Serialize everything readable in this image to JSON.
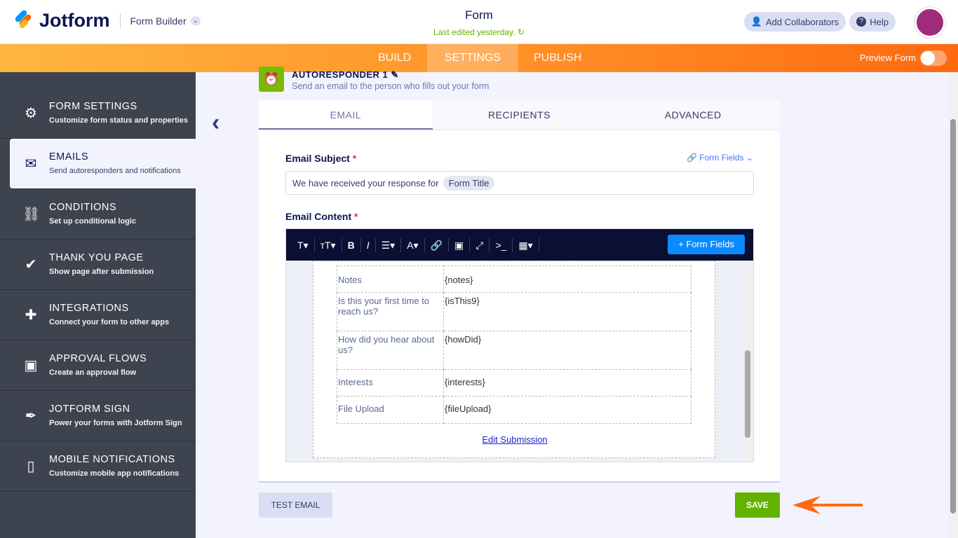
{
  "header": {
    "brand": "Jotform",
    "product": "Form Builder",
    "title": "Form",
    "edited": "Last edited yesterday.",
    "add_collaborators": "Add Collaborators",
    "help": "Help"
  },
  "nav": {
    "tabs": [
      "BUILD",
      "SETTINGS",
      "PUBLISH"
    ],
    "active": "SETTINGS",
    "preview": "Preview Form",
    "preview_on": false
  },
  "sidebar": {
    "items": [
      {
        "title": "FORM SETTINGS",
        "desc": "Customize form status and properties",
        "icon": "gear-icon"
      },
      {
        "title": "EMAILS",
        "desc": "Send autoresponders and notifications",
        "icon": "envelope-icon"
      },
      {
        "title": "CONDITIONS",
        "desc": "Set up conditional logic",
        "icon": "hierarchy-icon"
      },
      {
        "title": "THANK YOU PAGE",
        "desc": "Show page after submission",
        "icon": "check-circle-icon"
      },
      {
        "title": "INTEGRATIONS",
        "desc": "Connect your form to other apps",
        "icon": "puzzle-icon"
      },
      {
        "title": "APPROVAL FLOWS",
        "desc": "Create an approval flow",
        "icon": "flow-icon"
      },
      {
        "title": "JOTFORM SIGN",
        "desc": "Power your forms with Jotform Sign",
        "icon": "pen-icon"
      },
      {
        "title": "MOBILE NOTIFICATIONS",
        "desc": "Customize mobile app notifications",
        "icon": "mobile-icon"
      }
    ]
  },
  "autoresponder": {
    "title": "AUTORESPONDER 1",
    "desc": "Send an email to the person who fills out your form"
  },
  "tabs": [
    "EMAIL",
    "RECIPIENTS",
    "ADVANCED"
  ],
  "email": {
    "subject_label": "Email Subject",
    "required": "*",
    "form_fields": "Form Fields",
    "subject_text": "We have received your response for",
    "subject_tag": "Form Title",
    "content_label": "Email Content",
    "add_form_fields": "+ Form Fields",
    "rows": [
      {
        "k": "Notes",
        "v": "{notes}"
      },
      {
        "k": "Is this your first time to reach us?",
        "v": "{isThis9}"
      },
      {
        "k": "How did you hear about us?",
        "v": "{howDid}"
      },
      {
        "k": "Interests",
        "v": "{interests}"
      },
      {
        "k": "File Upload",
        "v": "{fileUpload}"
      }
    ],
    "edit_link": "Edit Submission"
  },
  "actions": {
    "test": "TEST EMAIL",
    "save": "SAVE"
  },
  "colors": {
    "accent": "#ff9026",
    "save": "#64b200",
    "arrow": "#ff6a10"
  }
}
